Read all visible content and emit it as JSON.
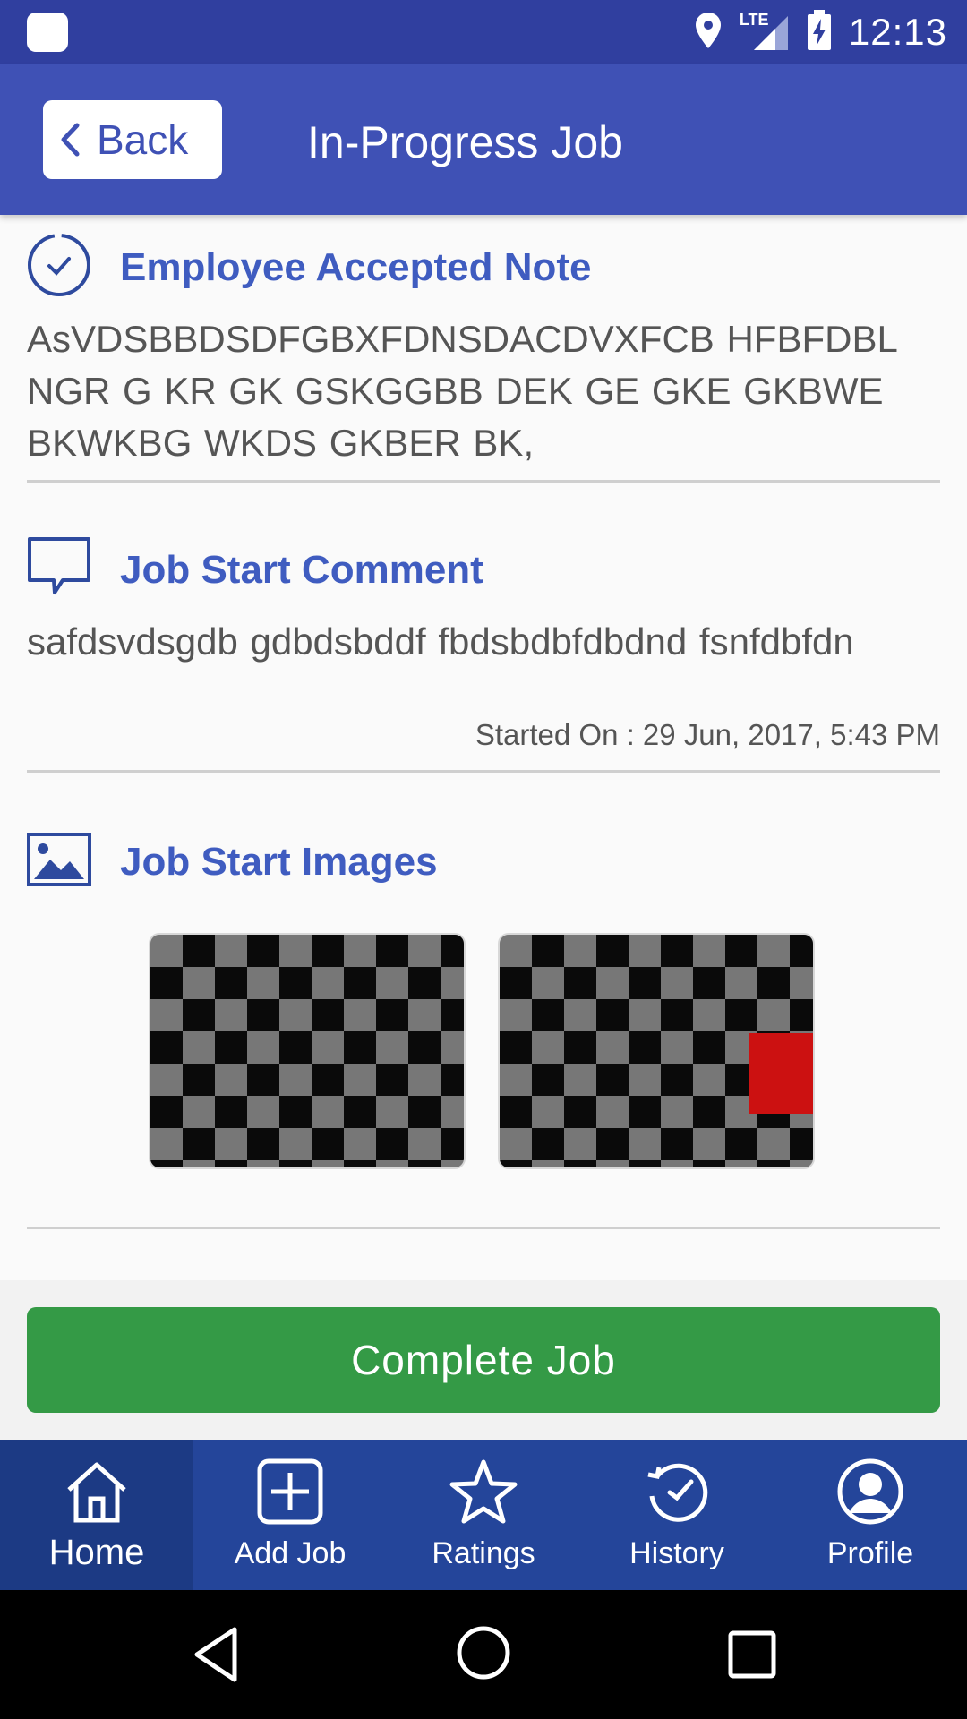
{
  "status_bar": {
    "network": "LTE",
    "time": "12:13"
  },
  "app_bar": {
    "back_label": "Back",
    "title": "In-Progress Job"
  },
  "accepted_note": {
    "title": "Employee Accepted Note",
    "text": "AsVDSBBDSDFGBXFDNSDACDVXFCB HFBFDBL NGR G KR  GK GSKGGBB DEK GE GKE GKBWE BKWKBG WKDS GKBER BK,"
  },
  "start_comment": {
    "title": "Job Start Comment",
    "text": "safdsvdsgdb gdbdsbddf fbdsbdbfdbdnd fsnfdbfdn",
    "started_on": "Started On : 29 Jun, 2017, 5:43 PM"
  },
  "start_images": {
    "title": "Job Start Images"
  },
  "actions": {
    "complete_label": "Complete Job"
  },
  "bottom_nav": {
    "items": [
      {
        "label": "Home",
        "icon": "home-icon",
        "active": true
      },
      {
        "label": "Add Job",
        "icon": "add-job-icon",
        "active": false
      },
      {
        "label": "Ratings",
        "icon": "star-icon",
        "active": false
      },
      {
        "label": "History",
        "icon": "history-icon",
        "active": false
      },
      {
        "label": "Profile",
        "icon": "profile-icon",
        "active": false
      }
    ]
  },
  "colors": {
    "status_bar": "#303f9f",
    "app_bar": "#3f51b5",
    "accent_text": "#3f5cc0",
    "complete_button": "#349a46",
    "bottom_nav": "#24459a"
  }
}
